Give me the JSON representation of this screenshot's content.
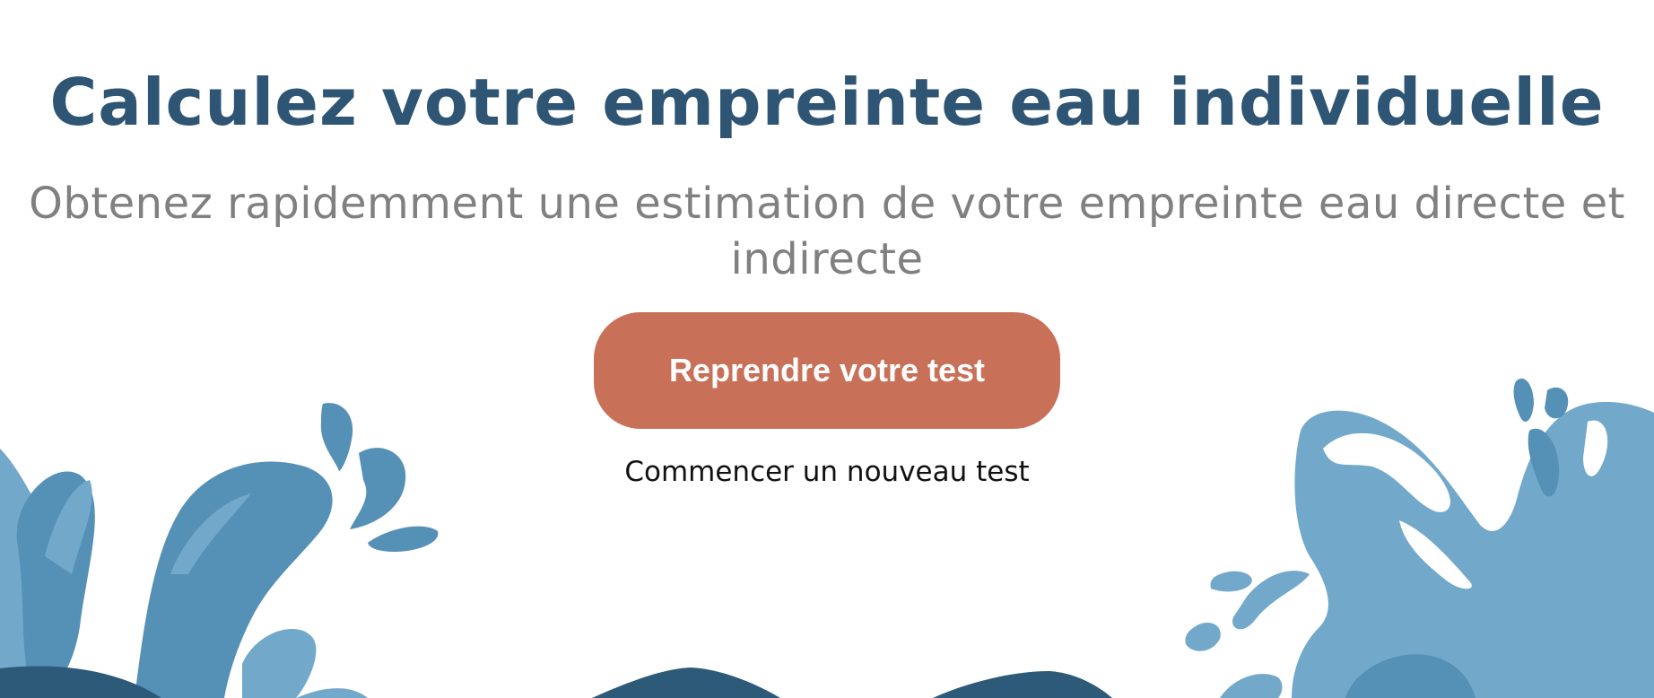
{
  "hero": {
    "title": "Calculez votre empreinte eau individuelle",
    "subtitle": "Obtenez rapidemment une estimation de votre empreinte eau directe et indirecte",
    "primary_button_label": "Reprendre votre test",
    "secondary_link_label": "Commencer un nouveau test"
  },
  "colors": {
    "title": "#2e5573",
    "subtitle": "#808080",
    "button": "#c97058",
    "splash_light": "#72a9cb",
    "splash_mid": "#5590b6",
    "wave_dark": "#2d5a78"
  }
}
